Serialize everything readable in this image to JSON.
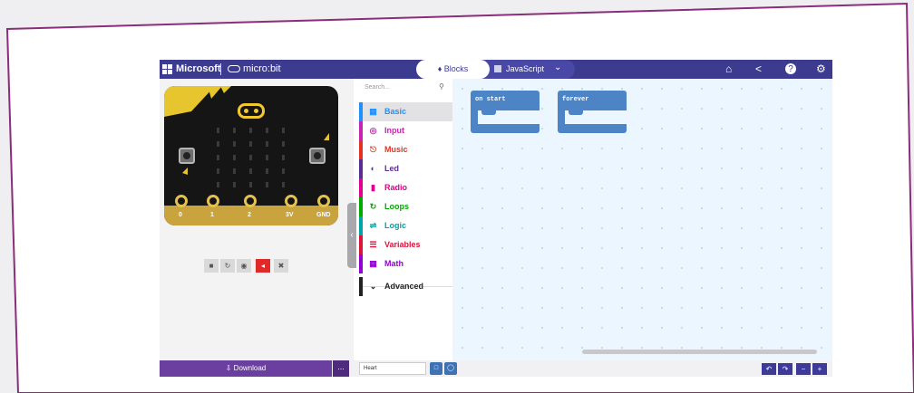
{
  "header": {
    "microsoft_label": "Microsoft",
    "microbit_label": "micro:bit",
    "tabs": [
      {
        "label": "Blocks",
        "active": true
      },
      {
        "label": "JavaScript",
        "active": false
      }
    ],
    "icons": [
      "home-icon",
      "share-icon",
      "help-icon",
      "settings-icon"
    ]
  },
  "simulator": {
    "pins": [
      "0",
      "1",
      "2",
      "3V",
      "GND"
    ],
    "controls": [
      "stop-icon",
      "restart-icon",
      "slow-mo-icon",
      "mute-icon",
      "fullscreen-icon"
    ]
  },
  "toolbox": {
    "search_placeholder": "Search...",
    "categories": [
      {
        "label": "Basic",
        "color": "#1e90ff",
        "icon": "grid-icon"
      },
      {
        "label": "Input",
        "color": "#c724b1",
        "icon": "target-icon"
      },
      {
        "label": "Music",
        "color": "#e63022",
        "icon": "headphones-icon"
      },
      {
        "label": "Led",
        "color": "#5c2d91",
        "icon": "toggle-icon"
      },
      {
        "label": "Radio",
        "color": "#e3008c",
        "icon": "signal-bars-icon"
      },
      {
        "label": "Loops",
        "color": "#00aa00",
        "icon": "loop-icon"
      },
      {
        "label": "Logic",
        "color": "#00a4a6",
        "icon": "shuffle-icon"
      },
      {
        "label": "Variables",
        "color": "#dc143c",
        "icon": "lines-icon"
      },
      {
        "label": "Math",
        "color": "#9400d3",
        "icon": "calculator-icon"
      }
    ],
    "advanced_label": "Advanced"
  },
  "workspace": {
    "blocks": [
      {
        "label": "on start",
        "color": "#4c84c6"
      },
      {
        "label": "forever",
        "color": "#4c84c6"
      }
    ]
  },
  "footer": {
    "download_label": "Download",
    "more_label": "...",
    "project_name": "Heart",
    "colors": {
      "download": "#6b3fa0",
      "accent": "#3d3b8f"
    }
  }
}
